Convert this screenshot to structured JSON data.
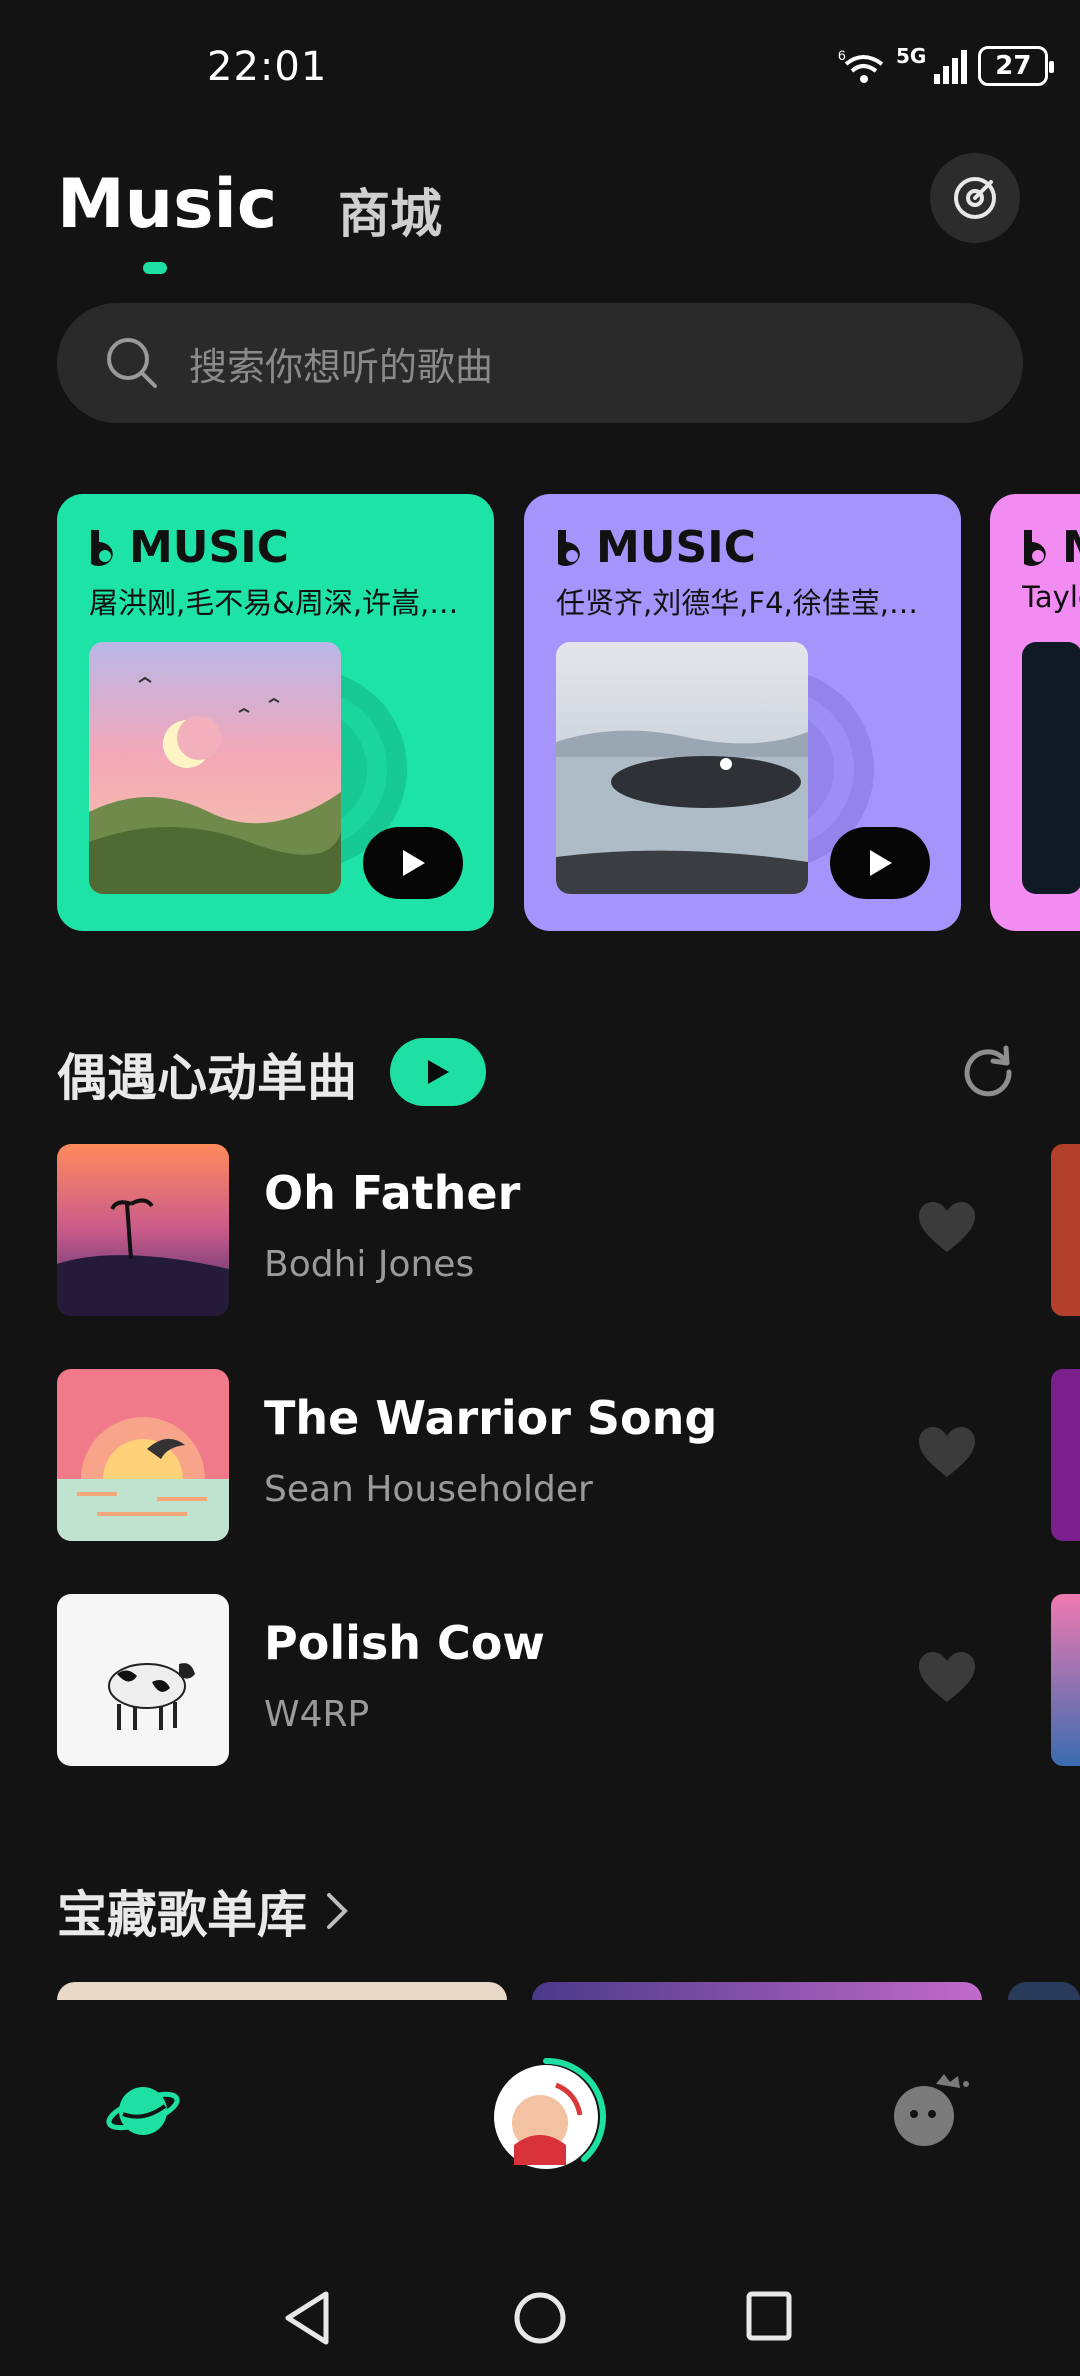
{
  "status": {
    "time": "22:01",
    "battery": "27",
    "wifi_label": "6",
    "network": "5G"
  },
  "header": {
    "tab_music": "Music",
    "tab_shop": "商城",
    "radar_icon": "radar-icon"
  },
  "search": {
    "placeholder": "搜索你想听的歌曲"
  },
  "cards": [
    {
      "brand": "MUSIC",
      "artists": "屠洪刚,毛不易&周深,许嵩,…",
      "bg": "#1ee3a7"
    },
    {
      "brand": "MUSIC",
      "artists": "任贤齐,刘德华,F4,徐佳莹,…",
      "bg": "#a594fb"
    },
    {
      "brand": "M",
      "artists": "Taylo",
      "bg": "#f28bf2"
    }
  ],
  "section_heart": {
    "title": "偶遇心动单曲"
  },
  "songs": [
    {
      "title": "Oh Father",
      "artist": "Bodhi Jones"
    },
    {
      "title": "The Warrior Song",
      "artist": "Sean Householder"
    },
    {
      "title": "Polish Cow",
      "artist": "W4RP"
    }
  ],
  "section_treasure": {
    "title": "宝藏歌单库"
  },
  "colors": {
    "accent": "#1ee0a3",
    "background": "#131313"
  }
}
